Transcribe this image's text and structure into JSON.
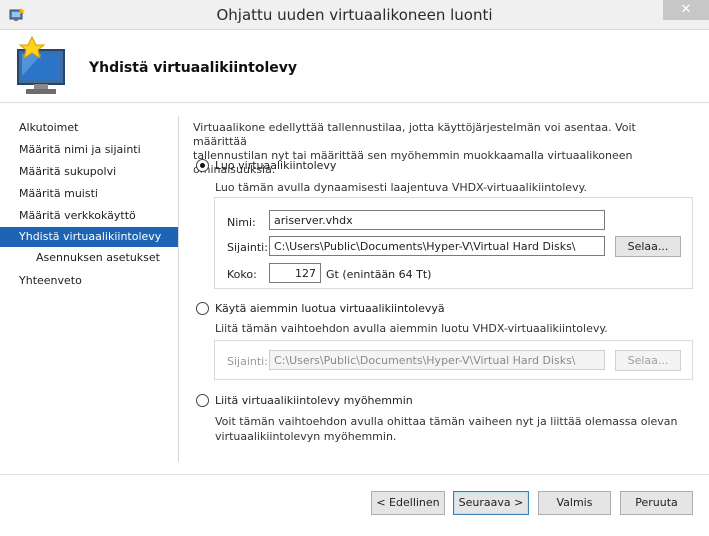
{
  "window": {
    "title": "Ohjattu uuden virtuaalikoneen luonti",
    "close_glyph": "✕"
  },
  "header": {
    "title": "Yhdistä virtuaalikiintolevy"
  },
  "sidebar": {
    "items": [
      {
        "label": "Alkutoimet"
      },
      {
        "label": "Määritä nimi ja sijainti"
      },
      {
        "label": "Määritä sukupolvi"
      },
      {
        "label": "Määritä muisti"
      },
      {
        "label": "Määritä verkkokäyttö"
      },
      {
        "label": "Yhdistä virtuaalikiintolevy"
      },
      {
        "label": "Asennuksen asetukset"
      },
      {
        "label": "Yhteenveto"
      }
    ]
  },
  "main": {
    "intro_line1": "Virtuaalikone edellyttää tallennustilaa, jotta käyttöjärjestelmän voi asentaa. Voit määrittää",
    "intro_line2": "tallennustilan nyt tai määrittää sen myöhemmin muokkaamalla virtuaalikoneen ominaisuuksia.",
    "option_create": {
      "label": "Luo virtuaalikiintolevy",
      "description": "Luo tämän avulla dynaamisesti laajentuva VHDX-virtuaalikiintolevy.",
      "name_label": "Nimi:",
      "name_value": "ariserver.vhdx",
      "location_label": "Sijainti:",
      "location_value": "C:\\Users\\Public\\Documents\\Hyper-V\\Virtual Hard Disks\\",
      "browse_label": "Selaa...",
      "size_label": "Koko:",
      "size_value": "127",
      "size_unit": "Gt (enintään 64 Tt)"
    },
    "option_existing": {
      "label": "Käytä aiemmin luotua virtuaalikiintolevyä",
      "description": "Liitä tämän vaihtoehdon avulla aiemmin luotu VHDX-virtuaalikiintolevy.",
      "location_label": "Sijainti:",
      "location_value": "C:\\Users\\Public\\Documents\\Hyper-V\\Virtual Hard Disks\\",
      "browse_label": "Selaa..."
    },
    "option_later": {
      "label": "Liitä virtuaalikiintolevy myöhemmin",
      "description_line1": "Voit tämän vaihtoehdon avulla ohittaa tämän vaiheen nyt ja liittää olemassa olevan",
      "description_line2": "virtuaalikiintolevyn myöhemmin."
    }
  },
  "footer": {
    "back_label": "< Edellinen",
    "next_label": "Seuraava >",
    "finish_label": "Valmis",
    "cancel_label": "Peruuta"
  },
  "colors": {
    "selected_nav": "#1e64b4",
    "default_button_border": "#3c7fb1"
  }
}
